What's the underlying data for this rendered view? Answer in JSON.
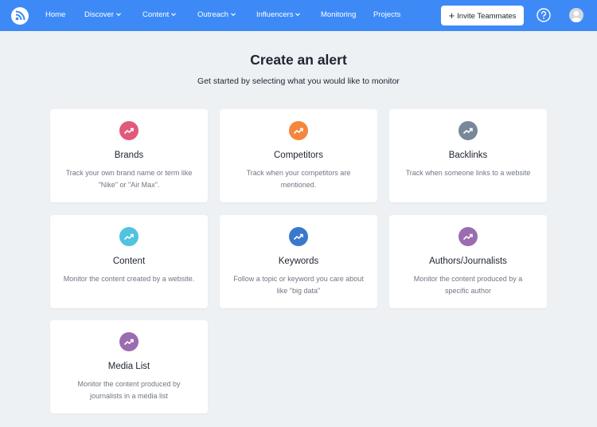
{
  "nav": {
    "items": [
      {
        "label": "Home",
        "dropdown": false
      },
      {
        "label": "Discover",
        "dropdown": true
      },
      {
        "label": "Content",
        "dropdown": true
      },
      {
        "label": "Outreach",
        "dropdown": true
      },
      {
        "label": "Influencers",
        "dropdown": true
      },
      {
        "label": "Monitoring",
        "dropdown": false
      },
      {
        "label": "Projects",
        "dropdown": false
      }
    ],
    "invite_label": "Invite Teammates",
    "icons": {
      "logo": "rss-feed-logo",
      "help": "question-circle-icon",
      "avatar": "user-avatar",
      "invite": "plus-icon"
    },
    "bg_color": "#3d8af7"
  },
  "page": {
    "title": "Create an alert",
    "subtitle": "Get started by selecting what you would like to monitor"
  },
  "cards": [
    {
      "title": "Brands",
      "desc": "Track your own brand name or term like \"Nike\" or \"Air Max\".",
      "color": "#e15a7c",
      "icon": "trending-up-icon"
    },
    {
      "title": "Competitors",
      "desc": "Track when your competitors are mentioned.",
      "color": "#f5863b",
      "icon": "trending-up-icon"
    },
    {
      "title": "Backlinks",
      "desc": "Track when someone links to a website",
      "color": "#78879a",
      "icon": "trending-up-icon"
    },
    {
      "title": "Content",
      "desc": "Monitor the content created by a website.",
      "color": "#4fc3e0",
      "icon": "trending-up-icon"
    },
    {
      "title": "Keywords",
      "desc": "Follow a topic or keyword you care about like \"big data\"",
      "color": "#3a78cc",
      "icon": "trending-up-icon"
    },
    {
      "title": "Authors/Journalists",
      "desc": "Monitor the content produced by a specific author",
      "color": "#9b6cb0",
      "icon": "trending-up-icon"
    },
    {
      "title": "Media List",
      "desc": "Monitor the content produced by journalists in a media list",
      "color": "#9b6cb0",
      "icon": "trending-up-icon"
    }
  ]
}
